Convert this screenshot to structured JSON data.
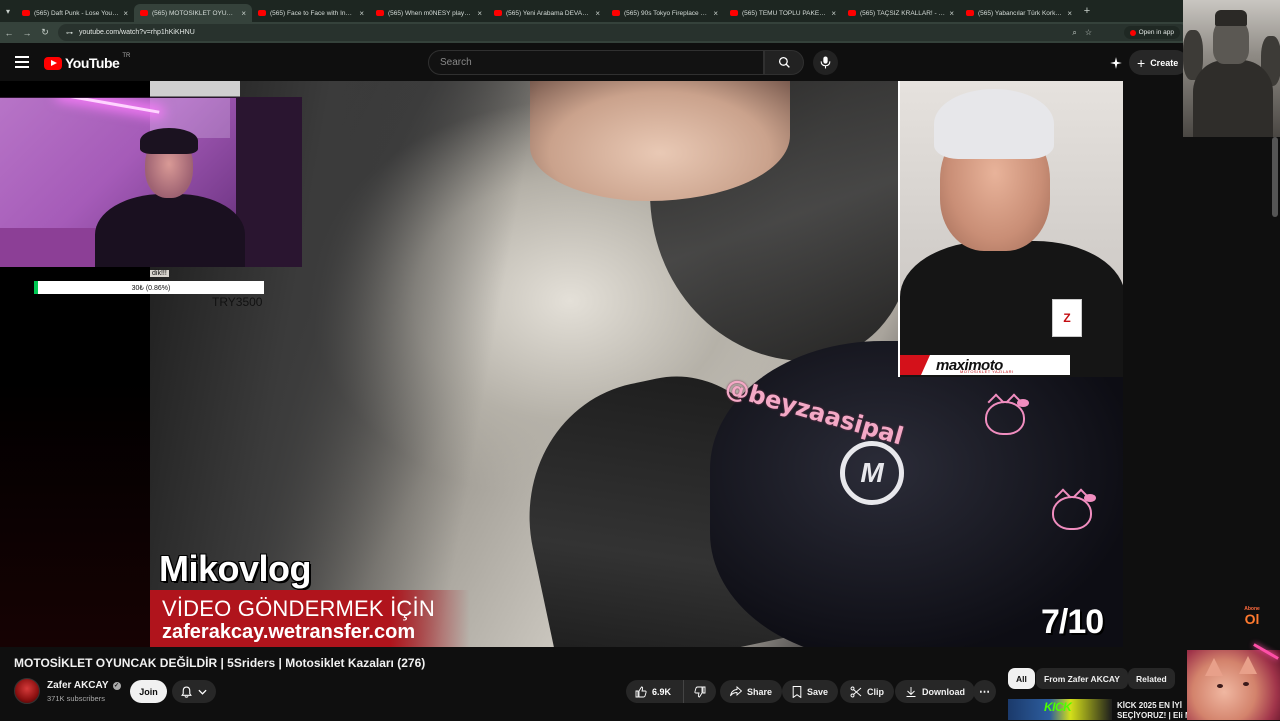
{
  "browser": {
    "tabs": [
      {
        "title": "(565) Daft Punk - Lose Yourself",
        "active": false
      },
      {
        "title": "(565) MOTOSİKLET OYUNCAK",
        "active": true
      },
      {
        "title": "(565) Face to Face with India's",
        "active": false
      },
      {
        "title": "(565) When m0NESY plays on",
        "active": false
      },
      {
        "title": "(565) Yeni Arabama DEVASA S",
        "active": false
      },
      {
        "title": "(565) 90s Tokyo Fireplace Drea",
        "active": false
      },
      {
        "title": "(565) TEMU TOPLU PAKET AÇIL",
        "active": false
      },
      {
        "title": "(565) TAÇSIZ KRALLAR! - 2025",
        "active": false
      },
      {
        "title": "(565) Yabancılar Türk Korku Film",
        "active": false
      }
    ],
    "url": "youtube.com/watch?v=rhp1hKiKHNU",
    "open_in_app_label": "Open in app"
  },
  "header": {
    "logo_text": "YouTube",
    "country_code": "TR",
    "search_placeholder": "Search",
    "create_label": "Create"
  },
  "video": {
    "overlay_channel": "Mikovlog",
    "overlay_line1": "VİDEO GÖNDERMEK İÇİN",
    "overlay_line2": "zaferakcay.wetransfer.com",
    "counter": "7/10",
    "brand_text": "@beyzaasipal",
    "presenter_brand": "maximoto",
    "presenter_brand_sub": "MOTOSİKLET YAZILARI",
    "donation_label": "dik!!!",
    "donation_progress": "30₺ (0.86%)",
    "donation_progress_fraction": 0.0086,
    "donation_goal": "TRY3500",
    "abone_top": "Abone",
    "abone_big": "Ol"
  },
  "video_info": {
    "title": "MOTOSİKLET OYUNCAK DEĞİLDİR | 5Sriders | Motosiklet Kazaları (276)",
    "channel_name": "Zafer AKCAY",
    "subscribers": "371K subscribers",
    "join_label": "Join",
    "likes": "6.9K",
    "share_label": "Share",
    "save_label": "Save",
    "clip_label": "Clip",
    "download_label": "Download"
  },
  "chips": [
    {
      "label": "All",
      "active": true
    },
    {
      "label": "From Zafer AKCAY",
      "active": false
    },
    {
      "label": "Related",
      "active": false
    }
  ],
  "recommendation": {
    "thumb_text": "KICK",
    "title_line1": "KİCK 2025 EN İYİ",
    "title_line2": "SEÇİYORUZ! | Eli M"
  },
  "colors": {
    "youtube_red": "#ff0000",
    "background": "#0f0f0f",
    "pill": "#272727",
    "overlay_red": "#b0141c",
    "donation_green": "#00c853"
  }
}
